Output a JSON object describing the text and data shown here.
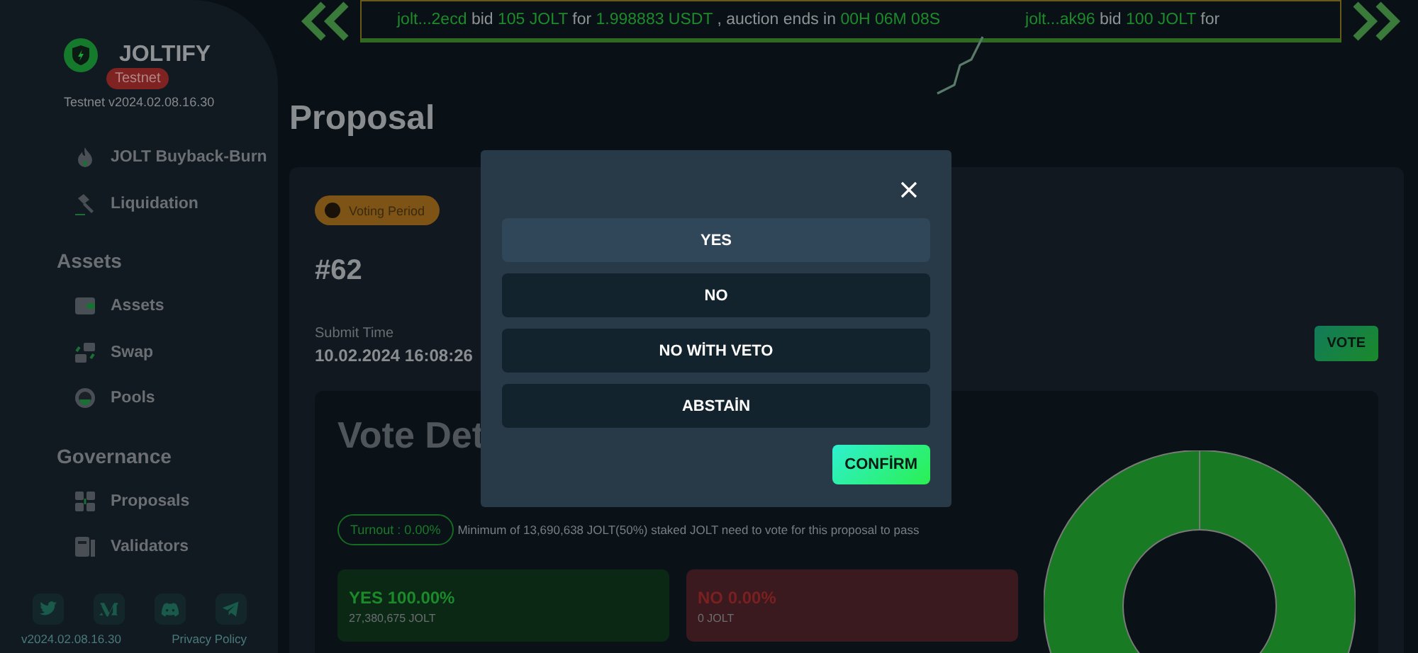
{
  "brand": {
    "name": "JOLTIFY",
    "badge": "Testnet",
    "version": "Testnet v2024.02.08.16.30"
  },
  "sidebar": {
    "items": [
      {
        "label": "JOLT Buyback-Burn"
      },
      {
        "label": "Liquidation"
      }
    ],
    "sections": [
      {
        "title": "Assets",
        "items": [
          {
            "label": "Assets"
          },
          {
            "label": "Swap"
          },
          {
            "label": "Pools"
          }
        ]
      },
      {
        "title": "Governance",
        "items": [
          {
            "label": "Proposals"
          },
          {
            "label": "Validators"
          }
        ]
      }
    ],
    "footer": {
      "version": "v2024.02.08.16.30",
      "link": "Privacy Policy"
    }
  },
  "ticker": [
    {
      "parts": [
        {
          "text": "jolt...2ecd",
          "kind": "highlight"
        },
        {
          "text": "bid",
          "kind": "plain"
        },
        {
          "text": "105 JOLT",
          "kind": "highlight"
        },
        {
          "text": "for",
          "kind": "plain"
        },
        {
          "text": "1.998883 USDT",
          "kind": "highlight"
        },
        {
          "text": ", auction ends in",
          "kind": "plain"
        },
        {
          "text": "00H 06M 08S",
          "kind": "highlight"
        }
      ]
    },
    {
      "parts": [
        {
          "text": "jolt...ak96",
          "kind": "highlight"
        },
        {
          "text": "bid",
          "kind": "plain"
        },
        {
          "text": "100 JOLT",
          "kind": "highlight"
        },
        {
          "text": "for",
          "kind": "plain"
        }
      ]
    }
  ],
  "page_title": "Proposal",
  "proposal": {
    "status": "Voting Period",
    "number": "#62",
    "submit_label": "Submit Time",
    "submit_time": "10.02.2024 16:08:26",
    "vote_button": "VOTE"
  },
  "vote_details": {
    "title": "Vote Det",
    "turnout": "Turnout : 0.00%",
    "note": "Minimum of 13,690,638 JOLT(50%) staked JOLT need to vote for this proposal to pass",
    "results": [
      {
        "label": "YES 100.00%",
        "amount": "27,380,675 JOLT",
        "kind": "yes"
      },
      {
        "label": "NO 0.00%",
        "amount": "0 JOLT",
        "kind": "no"
      }
    ]
  },
  "modal": {
    "options": [
      {
        "label": "YES",
        "selected": true
      },
      {
        "label": "NO",
        "selected": false
      },
      {
        "label": "NO WİTH VETO",
        "selected": false
      },
      {
        "label": "ABSTAİN",
        "selected": false
      }
    ],
    "confirm": "CONFİRM"
  }
}
